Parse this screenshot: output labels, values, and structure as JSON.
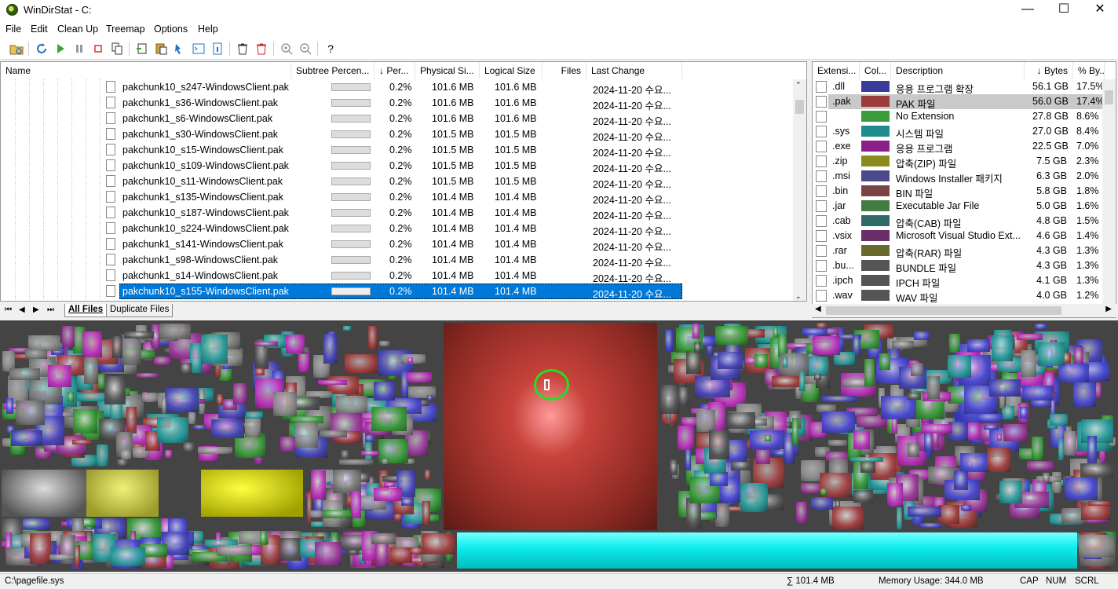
{
  "window": {
    "title": "WinDirStat - C:",
    "minimize": "—",
    "maximize": "☐",
    "close": "✕"
  },
  "menu": [
    "File",
    "Edit",
    "Clean Up",
    "Treemap",
    "Options",
    "Help"
  ],
  "toolbar": {
    "help_label": "?"
  },
  "tree": {
    "columns": [
      "Name",
      "Subtree Percen...",
      "↓ Per...",
      "Physical Si...",
      "Logical Size",
      "Files",
      "Last Change"
    ],
    "rows": [
      {
        "name": "pakchunk10_s247-WindowsClient.pak",
        "percent": "0.2%",
        "physical": "101.6 MB",
        "logical": "101.6 MB",
        "last_change": "2024-11-20 수요..."
      },
      {
        "name": "pakchunk1_s36-WindowsClient.pak",
        "percent": "0.2%",
        "physical": "101.6 MB",
        "logical": "101.6 MB",
        "last_change": "2024-11-20 수요..."
      },
      {
        "name": "pakchunk1_s6-WindowsClient.pak",
        "percent": "0.2%",
        "physical": "101.6 MB",
        "logical": "101.6 MB",
        "last_change": "2024-11-20 수요..."
      },
      {
        "name": "pakchunk1_s30-WindowsClient.pak",
        "percent": "0.2%",
        "physical": "101.5 MB",
        "logical": "101.5 MB",
        "last_change": "2024-11-20 수요..."
      },
      {
        "name": "pakchunk10_s15-WindowsClient.pak",
        "percent": "0.2%",
        "physical": "101.5 MB",
        "logical": "101.5 MB",
        "last_change": "2024-11-20 수요..."
      },
      {
        "name": "pakchunk10_s109-WindowsClient.pak",
        "percent": "0.2%",
        "physical": "101.5 MB",
        "logical": "101.5 MB",
        "last_change": "2024-11-20 수요..."
      },
      {
        "name": "pakchunk10_s11-WindowsClient.pak",
        "percent": "0.2%",
        "physical": "101.5 MB",
        "logical": "101.5 MB",
        "last_change": "2024-11-20 수요..."
      },
      {
        "name": "pakchunk1_s135-WindowsClient.pak",
        "percent": "0.2%",
        "physical": "101.4 MB",
        "logical": "101.4 MB",
        "last_change": "2024-11-20 수요..."
      },
      {
        "name": "pakchunk10_s187-WindowsClient.pak",
        "percent": "0.2%",
        "physical": "101.4 MB",
        "logical": "101.4 MB",
        "last_change": "2024-11-20 수요..."
      },
      {
        "name": "pakchunk10_s224-WindowsClient.pak",
        "percent": "0.2%",
        "physical": "101.4 MB",
        "logical": "101.4 MB",
        "last_change": "2024-11-20 수요..."
      },
      {
        "name": "pakchunk1_s141-WindowsClient.pak",
        "percent": "0.2%",
        "physical": "101.4 MB",
        "logical": "101.4 MB",
        "last_change": "2024-11-20 수요..."
      },
      {
        "name": "pakchunk1_s98-WindowsClient.pak",
        "percent": "0.2%",
        "physical": "101.4 MB",
        "logical": "101.4 MB",
        "last_change": "2024-11-20 수요..."
      },
      {
        "name": "pakchunk1_s14-WindowsClient.pak",
        "percent": "0.2%",
        "physical": "101.4 MB",
        "logical": "101.4 MB",
        "last_change": "2024-11-20 수요..."
      },
      {
        "name": "pakchunk10_s155-WindowsClient.pak",
        "percent": "0.2%",
        "physical": "101.4 MB",
        "logical": "101.4 MB",
        "last_change": "2024-11-20 수요...",
        "selected": true
      }
    ],
    "tabs": [
      "All Files",
      "Duplicate Files"
    ]
  },
  "extensions": {
    "columns": [
      "Extensi...",
      "Col...",
      "Description",
      "↓ Bytes",
      "% By..."
    ],
    "rows": [
      {
        "ext": ".dll",
        "color": "#3b3b9c",
        "description": "응용 프로그램 확장",
        "bytes": "56.1 GB",
        "percent": "17.5%"
      },
      {
        "ext": ".pak",
        "color": "#9c3b3b",
        "description": "PAK 파일",
        "bytes": "56.0 GB",
        "percent": "17.4%",
        "selected": true
      },
      {
        "ext": "",
        "color": "#3b9c3b",
        "description": "No Extension",
        "bytes": "27.8 GB",
        "percent": "8.6%"
      },
      {
        "ext": ".sys",
        "color": "#1e8c8c",
        "description": "시스템 파일",
        "bytes": "27.0 GB",
        "percent": "8.4%"
      },
      {
        "ext": ".exe",
        "color": "#8c1e8c",
        "description": "응용 프로그램",
        "bytes": "22.5 GB",
        "percent": "7.0%"
      },
      {
        "ext": ".zip",
        "color": "#8c8c1e",
        "description": "압축(ZIP) 파일",
        "bytes": "7.5 GB",
        "percent": "2.3%"
      },
      {
        "ext": ".msi",
        "color": "#4a4a8a",
        "description": "Windows Installer 패키지",
        "bytes": "6.3 GB",
        "percent": "2.0%"
      },
      {
        "ext": ".bin",
        "color": "#7a4444",
        "description": "BIN 파일",
        "bytes": "5.8 GB",
        "percent": "1.8%"
      },
      {
        "ext": ".jar",
        "color": "#447a44",
        "description": "Executable Jar File",
        "bytes": "5.0 GB",
        "percent": "1.6%"
      },
      {
        "ext": ".cab",
        "color": "#2e6a6a",
        "description": "압축(CAB) 파일",
        "bytes": "4.8 GB",
        "percent": "1.5%"
      },
      {
        "ext": ".vsix",
        "color": "#6a2e6a",
        "description": "Microsoft Visual Studio Ext...",
        "bytes": "4.6 GB",
        "percent": "1.4%"
      },
      {
        "ext": ".rar",
        "color": "#6a6a2e",
        "description": "압축(RAR) 파일",
        "bytes": "4.3 GB",
        "percent": "1.3%"
      },
      {
        "ext": ".bu...",
        "color": "#555555",
        "description": "BUNDLE 파일",
        "bytes": "4.3 GB",
        "percent": "1.3%"
      },
      {
        "ext": ".ipch",
        "color": "#555555",
        "description": "IPCH 파일",
        "bytes": "4.1 GB",
        "percent": "1.3%"
      },
      {
        "ext": ".wav",
        "color": "#555555",
        "description": "WAV 파일",
        "bytes": "4.0 GB",
        "percent": "1.2%"
      }
    ]
  },
  "status": {
    "path": "C:\\pagefile.sys",
    "size": "∑ 101.4 MB",
    "memory": "Memory Usage: 344.0 MB",
    "cap": "CAP",
    "num": "NUM",
    "scrl": "SCRL"
  }
}
